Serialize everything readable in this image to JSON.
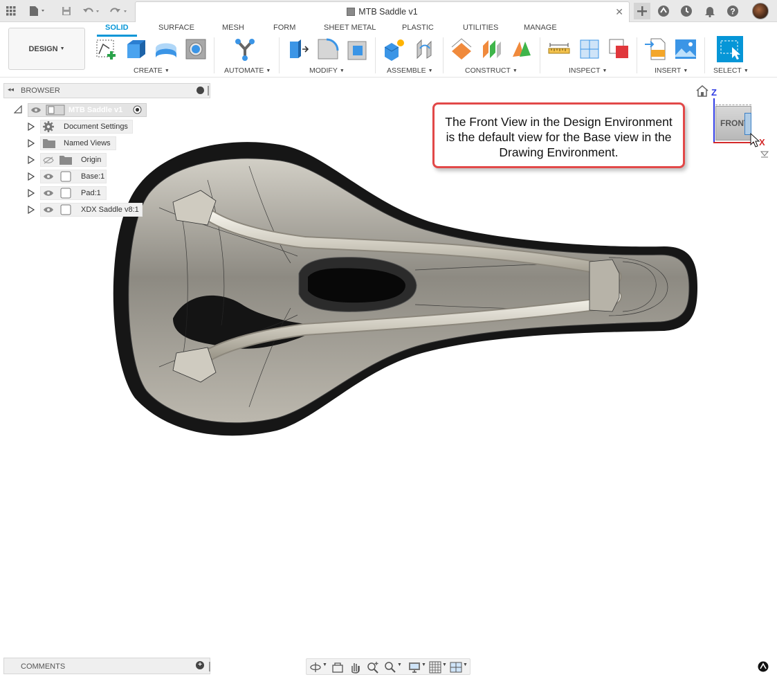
{
  "titlebar": {
    "document_title": "MTB Saddle v1",
    "icons": [
      "apps-grid-icon",
      "file-icon",
      "save-icon",
      "undo-icon",
      "redo-icon",
      "new-tab-icon",
      "extensions-icon",
      "job-status-icon",
      "notifications-icon",
      "help-icon",
      "profile-avatar"
    ]
  },
  "toolbar": {
    "workspace": "DESIGN",
    "tabs": [
      "SOLID",
      "SURFACE",
      "MESH",
      "FORM",
      "SHEET METAL",
      "PLASTIC",
      "UTILITIES",
      "MANAGE"
    ],
    "active_tab": "SOLID",
    "groups": [
      "CREATE",
      "AUTOMATE",
      "MODIFY",
      "ASSEMBLE",
      "CONSTRUCT",
      "INSPECT",
      "INSERT",
      "SELECT"
    ]
  },
  "browser": {
    "title": "BROWSER",
    "root": "MTB Saddle v1",
    "items": [
      {
        "label": "Document Settings",
        "icon": "gear-icon"
      },
      {
        "label": "Named Views",
        "icon": "folder-icon"
      },
      {
        "label": "Origin",
        "icon": "folder-icon"
      },
      {
        "label": "Base:1",
        "icon": "component-icon"
      },
      {
        "label": "Pad:1",
        "icon": "component-icon"
      },
      {
        "label": "XDX Saddle v8:1",
        "icon": "component-icon"
      }
    ]
  },
  "callout": {
    "text": "The Front View in the Design Environment is the default view for the Base view in the Drawing Environment."
  },
  "viewcube": {
    "face": "FRONT",
    "axis_z": "Z",
    "axis_x": "X"
  },
  "comments": {
    "title": "COMMENTS"
  },
  "colors": {
    "accent": "#0696d7",
    "callout_border": "#e24848"
  }
}
